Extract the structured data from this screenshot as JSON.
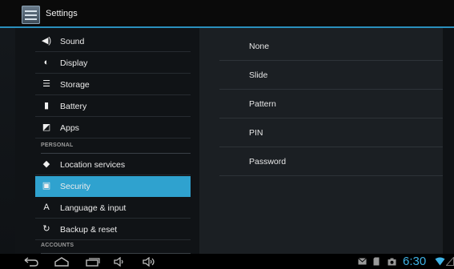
{
  "app": {
    "title": "Settings",
    "icon": "settings-app-icon"
  },
  "sidebar": {
    "items": [
      {
        "label": "Sound",
        "icon": "speaker-icon",
        "glyph": "◀)"
      },
      {
        "label": "Display",
        "icon": "brightness-icon",
        "glyph": "◐"
      },
      {
        "label": "Storage",
        "icon": "storage-icon",
        "glyph": "☰"
      },
      {
        "label": "Battery",
        "icon": "battery-icon",
        "glyph": "▮"
      },
      {
        "label": "Apps",
        "icon": "apps-icon",
        "glyph": "◩"
      }
    ],
    "personal_header": "PERSONAL",
    "personal_items": [
      {
        "label": "Location services",
        "icon": "location-icon",
        "glyph": "◆"
      },
      {
        "label": "Security",
        "icon": "lock-icon",
        "glyph": "▣",
        "selected": true
      },
      {
        "label": "Language & input",
        "icon": "keyboard-icon",
        "glyph": "A"
      },
      {
        "label": "Backup & reset",
        "icon": "backup-icon",
        "glyph": "↻"
      }
    ],
    "accounts_header": "ACCOUNTS"
  },
  "lock_options": [
    "None",
    "Slide",
    "Pattern",
    "PIN",
    "Password"
  ],
  "navbar": {
    "back": "back-icon",
    "home": "home-icon",
    "recents": "recent-apps-icon",
    "volume_down": "volume-down-icon",
    "volume_up": "volume-up-icon"
  },
  "status": {
    "time": "6:30",
    "icons": [
      "gmail-icon",
      "sd-card-icon",
      "screenshot-icon",
      "wifi-icon"
    ]
  },
  "colors": {
    "accent": "#2fa2cf",
    "clock": "#3fb3e6"
  }
}
